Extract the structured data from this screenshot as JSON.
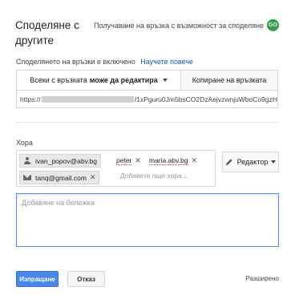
{
  "dialog": {
    "title": "Споделяне с другите",
    "get_link_label": "Получаване на връзка с възможност за споделяне",
    "get_link_icon": "GO"
  },
  "link_sharing": {
    "status": "Споделянето на връзки е включено",
    "learn_more": "Научете повече",
    "permission_prefix": "Всеки с връзката",
    "permission_value": "може да редактира",
    "copy_label": "Копиране на връзката",
    "url_prefix": "https://",
    "url_suffix": "/1xPguru0Jm5bsCO2DzAejvzwnjuWboCo9gzH"
  },
  "people": {
    "label": "Хора",
    "chips": [
      {
        "text": "ivan_popov@abv.bg",
        "icon": "person-icon"
      },
      {
        "text": "peter"
      },
      {
        "text": "maria.abv.bg"
      },
      {
        "text": "tanq@gmail.com",
        "icon": "mail-icon"
      }
    ],
    "add_placeholder": "Добавете още хора...",
    "role": "Редактор"
  },
  "note": {
    "placeholder": "Добавяне на бележка"
  },
  "footer": {
    "send": "Изпращане",
    "cancel": "Отказ",
    "advanced": "Разширено"
  },
  "colors": {
    "accent": "#4a86e8",
    "link": "#1155cc",
    "go_badge": "#2f9e44",
    "error_underline": "#d93025"
  }
}
